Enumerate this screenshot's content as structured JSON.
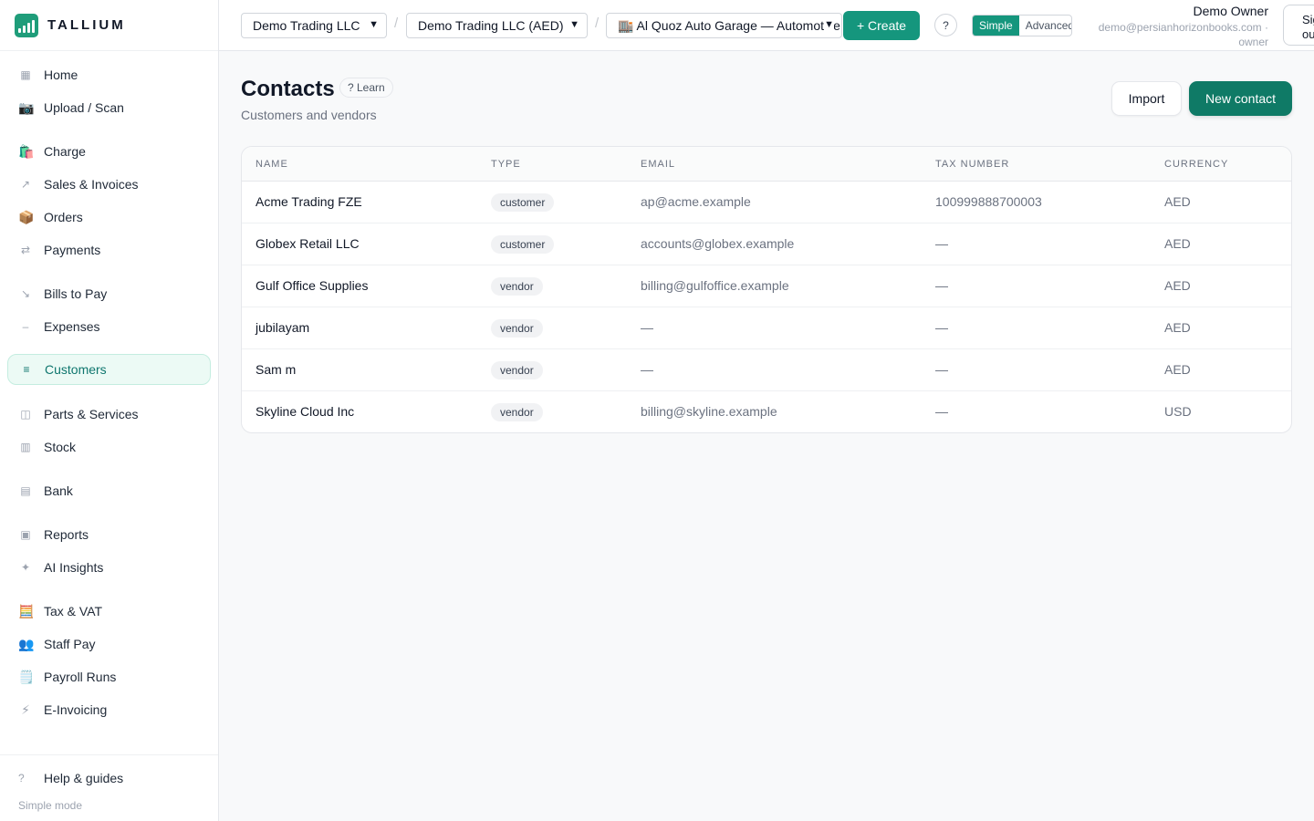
{
  "app": {
    "name": "TALLIUM",
    "brand_color": "#15967d"
  },
  "topbar": {
    "company_select": "Demo Trading LLC",
    "ledger_select": "Demo Trading LLC (AED)",
    "branch_select": "🏬 Al Quoz Auto Garage — Automotive",
    "create_label": "+ Create",
    "help_label": "?",
    "mode_simple": "Simple",
    "mode_advanced": "Advanced",
    "user_name": "Demo Owner",
    "user_email": "demo@persianhorizonbooks.com · owner",
    "signout_label": "Sign out"
  },
  "sidebar": {
    "items": [
      {
        "label": "Home",
        "icon": "grid-icon",
        "glyph": "▦"
      },
      {
        "label": "Upload / Scan",
        "icon": "camera-icon",
        "glyph": "📷"
      },
      {
        "label": "Charge",
        "icon": "shopping-bags-icon",
        "glyph": "🛍️"
      },
      {
        "label": "Sales & Invoices",
        "icon": "arrow-up-right-icon",
        "glyph": "↗"
      },
      {
        "label": "Orders",
        "icon": "package-icon",
        "glyph": "📦"
      },
      {
        "label": "Payments",
        "icon": "swap-arrows-icon",
        "glyph": "⇄"
      },
      {
        "label": "Bills to Pay",
        "icon": "arrow-down-right-icon",
        "glyph": "↘"
      },
      {
        "label": "Expenses",
        "icon": "minus-icon",
        "glyph": "–"
      },
      {
        "label": "Customers",
        "icon": "list-icon",
        "glyph": "≡"
      },
      {
        "label": "Parts & Services",
        "icon": "box-icon",
        "glyph": "◫"
      },
      {
        "label": "Stock",
        "icon": "shelves-icon",
        "glyph": "▥"
      },
      {
        "label": "Bank",
        "icon": "bank-icon",
        "glyph": "▤"
      },
      {
        "label": "Reports",
        "icon": "report-icon",
        "glyph": "▣"
      },
      {
        "label": "AI Insights",
        "icon": "sparkle-icon",
        "glyph": "✦"
      },
      {
        "label": "Tax & VAT",
        "icon": "abacus-icon",
        "glyph": "🧮"
      },
      {
        "label": "Staff Pay",
        "icon": "people-icon",
        "glyph": "👥"
      },
      {
        "label": "Payroll Runs",
        "icon": "ledger-icon",
        "glyph": "🗒️"
      },
      {
        "label": "E-Invoicing",
        "icon": "lightning-icon",
        "glyph": "⚡"
      }
    ],
    "help_label": "Help & guides",
    "help_glyph": "?",
    "mode_label": "Simple mode"
  },
  "main": {
    "title": "Contacts",
    "learn_label": "? Learn",
    "subtitle": "Customers and vendors",
    "import_label": "Import",
    "new_contact_label": "New contact",
    "table": {
      "columns": [
        "NAME",
        "TYPE",
        "EMAIL",
        "TAX NUMBER",
        "CURRENCY"
      ],
      "rows": [
        {
          "name": "Acme Trading FZE",
          "type": "customer",
          "email": "ap@acme.example",
          "tax": "100999888700003",
          "currency": "AED"
        },
        {
          "name": "Globex Retail LLC",
          "type": "customer",
          "email": "accounts@globex.example",
          "tax": "—",
          "currency": "AED"
        },
        {
          "name": "Gulf Office Supplies",
          "type": "vendor",
          "email": "billing@gulfoffice.example",
          "tax": "—",
          "currency": "AED"
        },
        {
          "name": "jubilayam",
          "type": "vendor",
          "email": "—",
          "tax": "—",
          "currency": "AED"
        },
        {
          "name": "Sam m",
          "type": "vendor",
          "email": "—",
          "tax": "—",
          "currency": "AED"
        },
        {
          "name": "Skyline Cloud Inc",
          "type": "vendor",
          "email": "billing@skyline.example",
          "tax": "—",
          "currency": "USD"
        }
      ]
    }
  }
}
